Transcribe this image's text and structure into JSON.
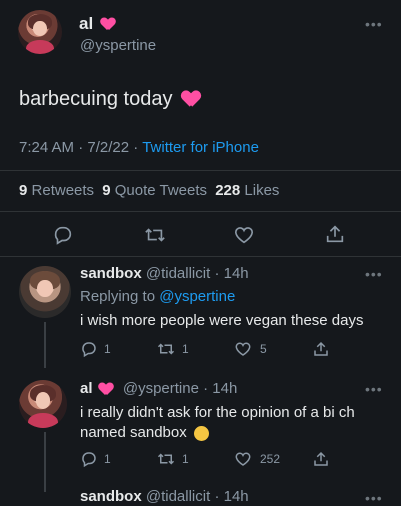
{
  "main_tweet": {
    "display_name": "al",
    "handle": "@yspertine",
    "text": "barbecuing today",
    "time": "7:24 AM",
    "date": "7/2/22",
    "source": "Twitter for iPhone",
    "retweets_count": "9",
    "retweets_label": "Retweets",
    "quote_count": "9",
    "quote_label": "Quote Tweets",
    "likes_count": "228",
    "likes_label": "Likes"
  },
  "reply1": {
    "display_name": "sandbox",
    "handle": "@tidallicit",
    "age": "14h",
    "replying_prefix": "Replying to",
    "replying_handle": "@yspertine",
    "text": "i wish more people were vegan these days",
    "reply_count": "1",
    "retweet_count": "1",
    "like_count": "5"
  },
  "reply2": {
    "display_name": "al",
    "handle": "@yspertine",
    "age": "14h",
    "text": "i really didn't ask for the opinion of a bi ch named sandbox",
    "reply_count": "1",
    "retweet_count": "1",
    "like_count": "252"
  },
  "reply3_partial": {
    "display_name": "sandbox",
    "handle": "@tidallicit",
    "age": "14h"
  },
  "separator": "·",
  "more_icon": "more-horizontal-icon",
  "colors": {
    "background": "#15181c",
    "text": "#e7e9ea",
    "muted": "#8b98a5",
    "link": "#1d9bf0",
    "heart": "#ff4fa3"
  }
}
